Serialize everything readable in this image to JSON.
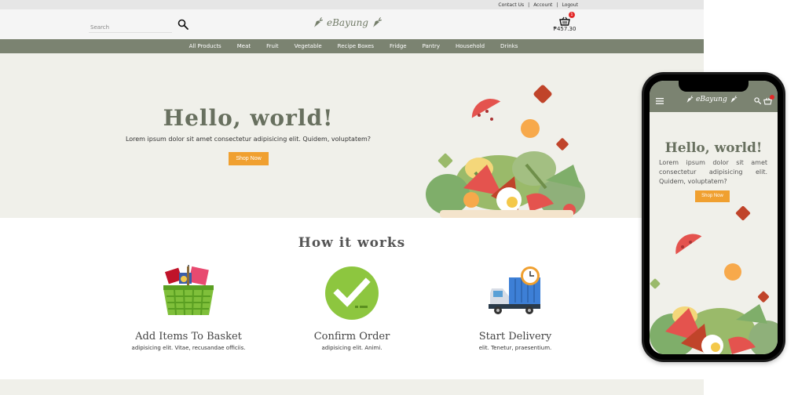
{
  "topbar": {
    "links": [
      "Contact Us",
      "Account",
      "Logout"
    ]
  },
  "header": {
    "search_placeholder": "Search",
    "logo_text": "eBayung",
    "cart_count": "1",
    "cart_total": "₱457.30"
  },
  "nav": {
    "items": [
      "All Products",
      "Meat",
      "Fruit",
      "Vegetable",
      "Recipe Boxes",
      "Fridge",
      "Pantry",
      "Household",
      "Drinks"
    ]
  },
  "hero": {
    "title": "Hello, world!",
    "subtitle": "Lorem ipsum dolor sit amet consectetur adipisicing elit. Quidem, voluptatem?",
    "button": "Shop Now"
  },
  "how": {
    "title": "How it works",
    "steps": [
      {
        "title": "Add Items To Basket",
        "text": "adipisicing elit. Vitae, recusandae officiis.",
        "icon": "basket-icon"
      },
      {
        "title": "Confirm Order",
        "text": "adipisicing elit. Animi.",
        "icon": "check-icon"
      },
      {
        "title": "Start Delivery",
        "text": "elit. Tenetur, praesentium.",
        "icon": "truck-icon"
      }
    ]
  },
  "mobile": {
    "logo_text": "eBayung",
    "title": "Hello, world!",
    "subtitle": "Lorem ipsum dolor sit amet consectetur adipisicing elit. Quidem, voluptatem?",
    "button": "Shop Now"
  },
  "colors": {
    "nav_bg": "#7b8371",
    "hero_bg": "#f0f0ea",
    "accent": "#f0a030",
    "badge": "#e32828",
    "title": "#68705f"
  }
}
